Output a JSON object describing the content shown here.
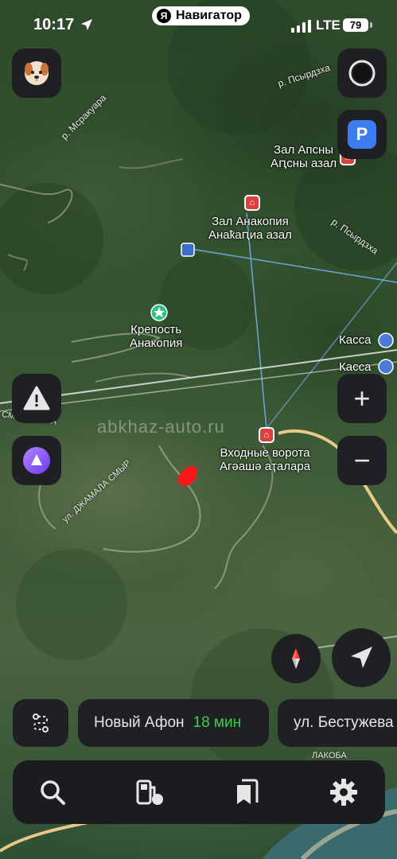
{
  "status_bar": {
    "time": "10:17",
    "network": "LTE",
    "battery": "79"
  },
  "app_header": {
    "logo_letter": "Я",
    "title": "Навигатор"
  },
  "map": {
    "watermark": "abkhaz-auto.ru",
    "labels": {
      "hall_apsny": "Зал Апсны",
      "hall_apsny_abkhaz": "Аԥсны азал",
      "hall_anakopia": "Зал Анакопия",
      "hall_anakopia_abkhaz": "Анаҟаԥиа азал",
      "fortress_line1": "Крепость",
      "fortress_line2": "Анакопия",
      "entrance_gate": "Входные ворота",
      "entrance_gate_abkhaz": "Агәашә аҭалара",
      "cashbox_1": "Касса",
      "cashbox_2": "Касса"
    },
    "streets": {
      "river_mrakuara": "р. Мсракуара",
      "river_psyrdzkha_top": "р. Псырдзха",
      "river_psyrdzkha_right": "р. Псырдзха",
      "imfa_street": "СМЫР ИМФА",
      "dzhamala_street": "ул. ДЖАМАЛА СМЫР",
      "lakoba_street": "ЛАКОБА"
    }
  },
  "controls": {
    "profile_icon": "dog-avatar-icon",
    "layers_icon": "circle-icon",
    "parking_label": "P",
    "alert_icon": "warning-icon",
    "alice_icon": "alice-icon",
    "zoom_in_label": "+",
    "zoom_out_label": "−",
    "compass_icon": "compass-icon",
    "locate_icon": "navigation-arrow-icon"
  },
  "route_bar": {
    "route_icon": "route-icon",
    "destination": "Новый Афон",
    "eta": "18 мин",
    "next_destination": "ул. Бестужева"
  },
  "bottom_bar": {
    "items": [
      "search-icon",
      "gas-station-icon",
      "bookmarks-icon",
      "settings-icon"
    ]
  },
  "colors": {
    "button_bg": "#1f2023",
    "eta_green": "#3fcf4a",
    "poi_red": "#d94040",
    "parking_blue": "#3d7cf0",
    "alice_purple": "#8a5cff"
  }
}
